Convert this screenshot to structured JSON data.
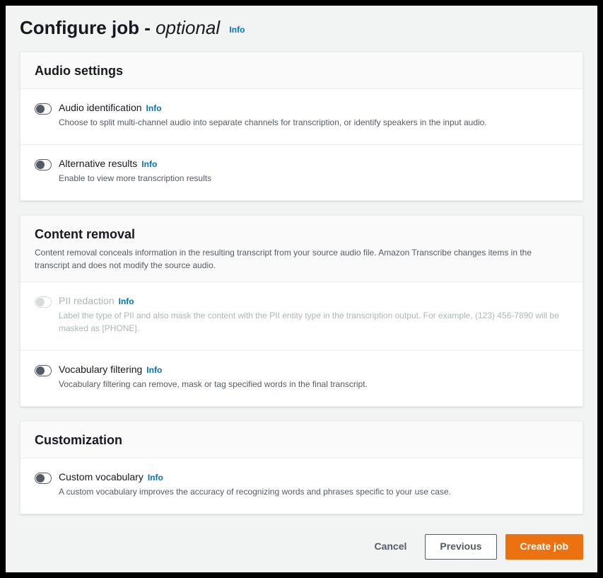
{
  "header": {
    "title_prefix": "Configure job",
    "title_dash": " - ",
    "title_optional": "optional",
    "info": "Info"
  },
  "sections": {
    "audio": {
      "title": "Audio settings",
      "options": {
        "identification": {
          "title": "Audio identification",
          "info": "Info",
          "desc": "Choose to split multi-channel audio into separate channels for transcription, or identify speakers in the input audio."
        },
        "alternative": {
          "title": "Alternative results",
          "info": "Info",
          "desc": "Enable to view more transcription results"
        }
      }
    },
    "content_removal": {
      "title": "Content removal",
      "subtitle": "Content removal conceals information in the resulting transcript from your source audio file. Amazon Transcribe changes items in the transcript and does not modify the source audio.",
      "options": {
        "pii": {
          "title": "PII redaction",
          "info": "Info",
          "desc": "Label the type of PII and also mask the content with the PII entity type in the transcription output. For example, (123) 456-7890 will be masked as [PHONE]."
        },
        "vocab_filter": {
          "title": "Vocabulary filtering",
          "info": "Info",
          "desc": "Vocabulary filtering can remove, mask or tag specified words in the final transcript."
        }
      }
    },
    "customization": {
      "title": "Customization",
      "options": {
        "custom_vocab": {
          "title": "Custom vocabulary",
          "info": "Info",
          "desc": "A custom vocabulary improves the accuracy of recognizing words and phrases specific to your use case."
        }
      }
    }
  },
  "footer": {
    "cancel": "Cancel",
    "previous": "Previous",
    "create": "Create job"
  }
}
